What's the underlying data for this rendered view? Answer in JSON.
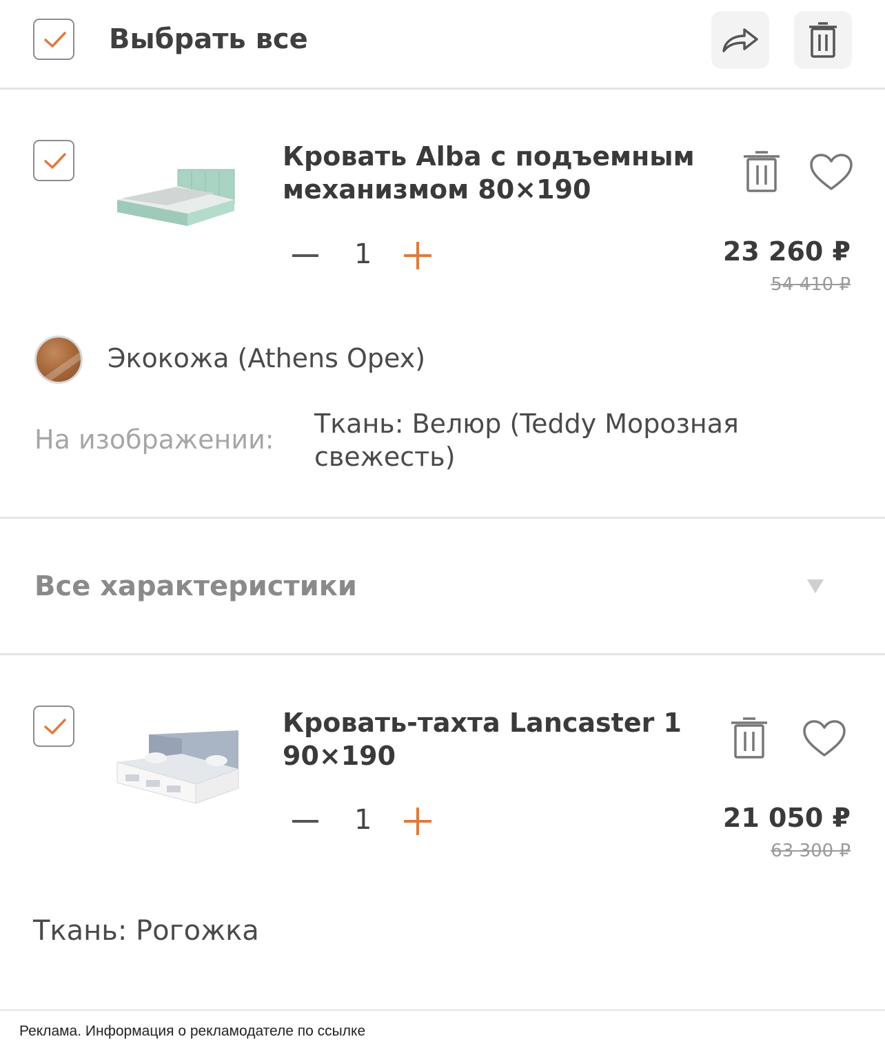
{
  "header": {
    "select_all_label": "Выбрать все",
    "share_icon": "share-icon",
    "delete_icon": "trash-icon"
  },
  "products": [
    {
      "title_line1": "Кровать Alba с подъемным",
      "title_line2": "механизмом 80×190",
      "selected": true,
      "quantity": "1",
      "price": "23 260 ₽",
      "old_price": "54 410 ₽",
      "material": "Экокожа (Athens Opex)",
      "image_caption_key": "На изображении:",
      "image_caption_line1": "Ткань: Велюр (Teddy Морозная",
      "image_caption_line2": "свежесть)",
      "thumb_color": "#a9d3c2"
    },
    {
      "title_line1": "Кровать-тахта Lancaster 1",
      "title_line2": "90×190",
      "selected": true,
      "quantity": "1",
      "price": "21 050 ₽",
      "old_price": "63 300 ₽",
      "fabric": "Ткань: Рогожка",
      "thumb_color": "#a9b4c4"
    }
  ],
  "specs": {
    "all_specs_label": "Все характеристики"
  },
  "footer": {
    "ad_note": "Реклама. Информация о рекламодателе по ссылке"
  },
  "colors": {
    "accent": "#e07a3c",
    "divider": "#e4e4e4"
  }
}
